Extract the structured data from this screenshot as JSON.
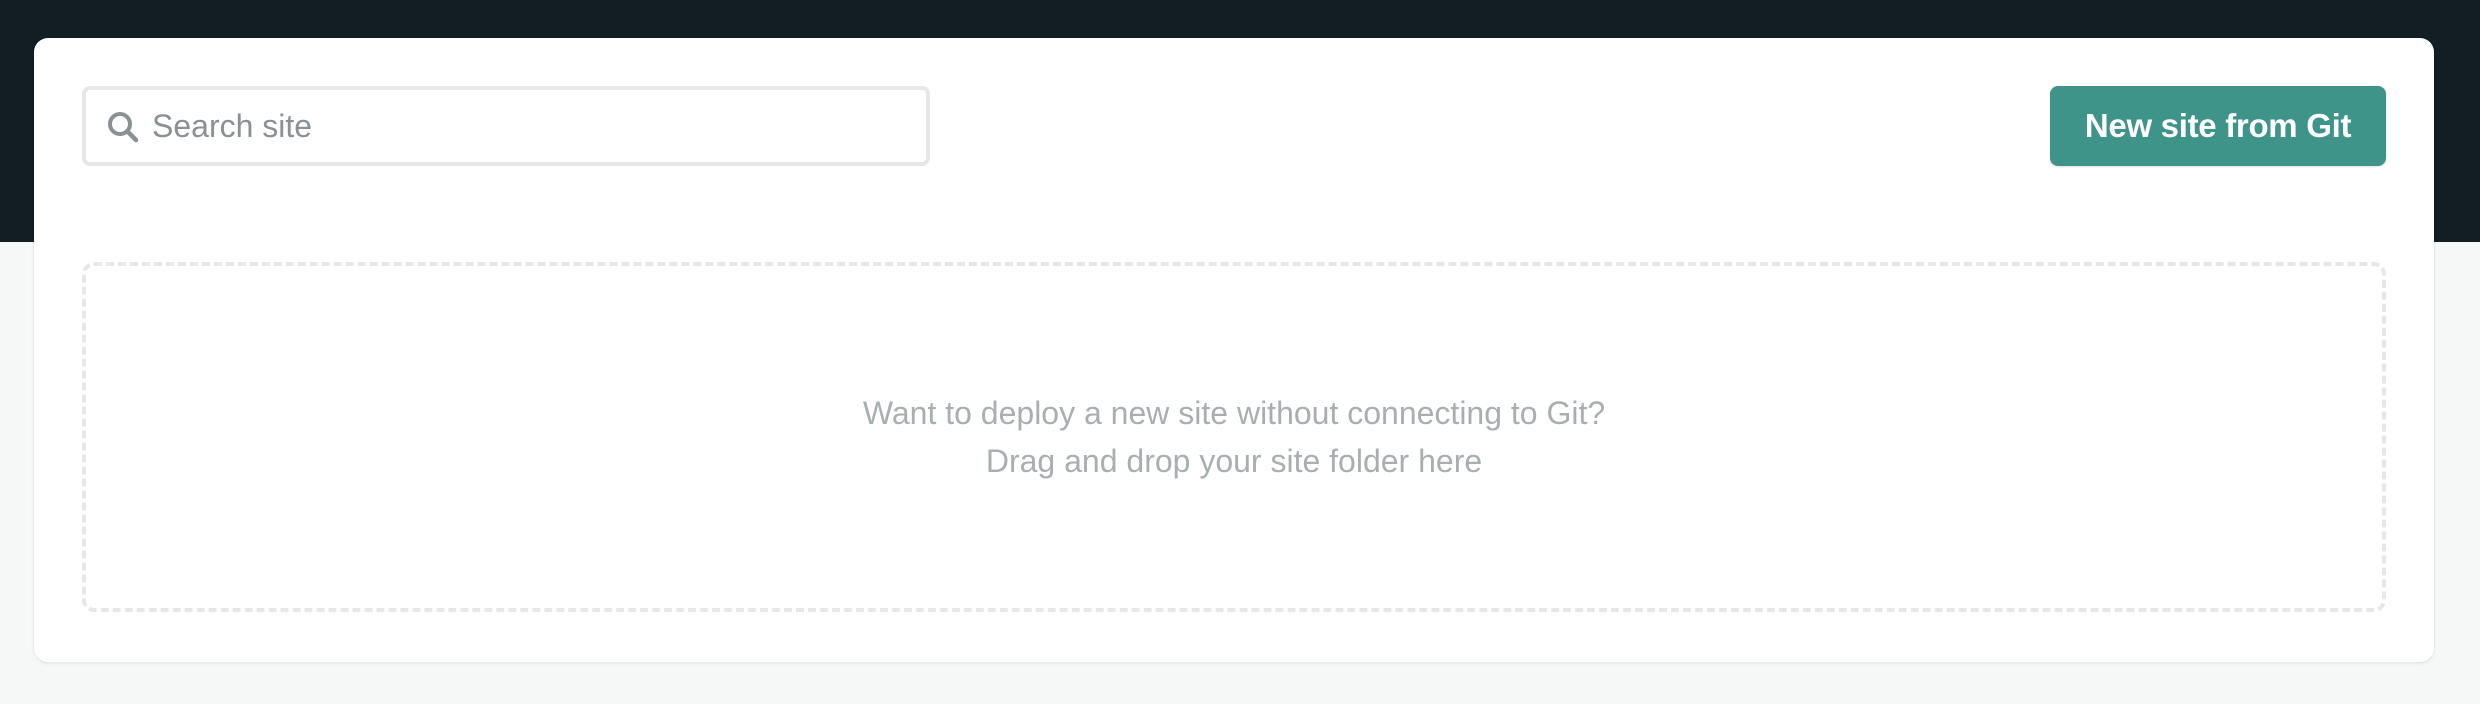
{
  "search": {
    "placeholder": "Search site",
    "value": "",
    "icon": "search-icon"
  },
  "toolbar": {
    "new_site_label": "New site from Git"
  },
  "dropzone": {
    "line1": "Want to deploy a new site without connecting to Git?",
    "line2": "Drag and drop your site folder here"
  },
  "colors": {
    "header_background": "#121e24",
    "page_background": "#f6f8f8",
    "accent": "#3f9489",
    "muted_text": "#a9aeb0",
    "border": "#e6e8e8"
  }
}
